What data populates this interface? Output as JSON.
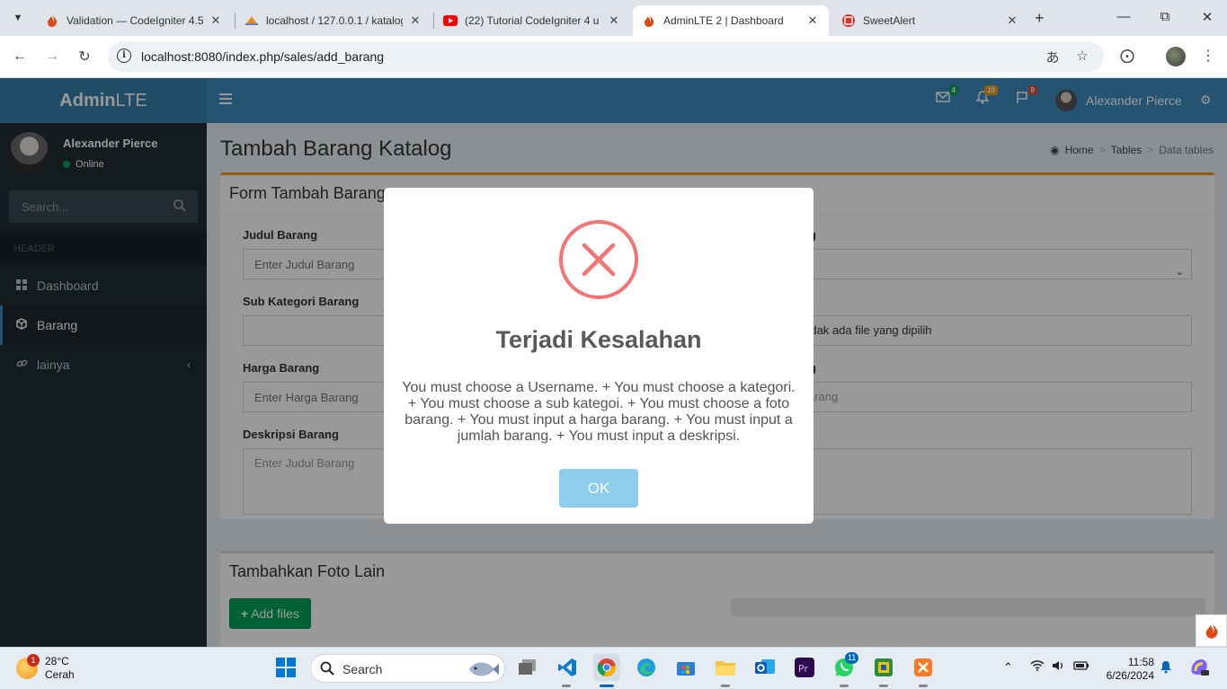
{
  "browser": {
    "tabs": [
      {
        "title": "Validation — CodeIgniter 4.5",
        "icon": "codeigniter-icon",
        "active": false
      },
      {
        "title": "localhost / 127.0.0.1 / katalog",
        "icon": "phpmyadmin-icon",
        "active": false
      },
      {
        "title": "(22) Tutorial CodeIgniter 4 u",
        "icon": "youtube-icon",
        "active": false
      },
      {
        "title": "AdminLTE 2 | Dashboard",
        "icon": "codeigniter-icon",
        "active": true
      },
      {
        "title": "SweetAlert",
        "icon": "sweetalert-icon",
        "active": false
      }
    ],
    "url": "localhost:8080/index.php/sales/add_barang"
  },
  "app": {
    "logo_bold": "Admin",
    "logo_light": "LTE",
    "nav_badges": {
      "messages": "4",
      "notifications": "10",
      "tasks": "9"
    },
    "nav_user": "Alexander Pierce",
    "sidebar": {
      "user_name": "Alexander Pierce",
      "status": "Online",
      "search_placeholder": "Search...",
      "header": "HEADER",
      "items": [
        {
          "label": "Dashboard",
          "icon": "dashboard-icon"
        },
        {
          "label": "Barang",
          "icon": "cube-icon"
        },
        {
          "label": "lainya",
          "icon": "link-icon"
        }
      ]
    },
    "page_title": "Tambah Barang Katalog",
    "breadcrumb": [
      "Home",
      "Tables",
      "Data tables"
    ],
    "form": {
      "title": "Form Tambah Barang",
      "judul_label": "Judul Barang",
      "judul_placeholder": "Enter Judul Barang",
      "kategori_label_tail": "g",
      "sub_label": "Sub Kategori Barang",
      "file_text": "Tidak ada file yang dipilih",
      "harga_label": "Harga Barang",
      "harga_placeholder": "Enter Harga Barang",
      "jumlah_label_tail": "g",
      "jumlah_placeholder_tail": "arang",
      "deskripsi_label": "Deskripsi Barang",
      "deskripsi_placeholder": "Enter Judul Barang"
    },
    "foto": {
      "title": "Tambahkan Foto Lain",
      "add_button": "Add files"
    }
  },
  "alert": {
    "icon": "error-icon",
    "title": "Terjadi Kesalahan",
    "text": "You must choose a Username. + You must choose a kategori. + You must choose a sub kategoi. + You must choose a foto barang. + You must input a harga barang. + You must input a jumlah barang. + You must input a deskripsi.",
    "ok_label": "OK"
  },
  "taskbar": {
    "weather_temp": "28°C",
    "weather_desc": "Cerah",
    "weather_badge": "1",
    "search_label": "Search",
    "whatsapp_badge": "11",
    "time": "11:58",
    "date": "6/26/2024"
  },
  "colors": {
    "topnav": "#3c8dbc",
    "logo": "#367fa9",
    "sidebar": "#222d32",
    "error_red": "#f27474",
    "ok_button": "#8fcdee",
    "success_green": "#00a65a",
    "warning_orange": "#f39c12"
  }
}
